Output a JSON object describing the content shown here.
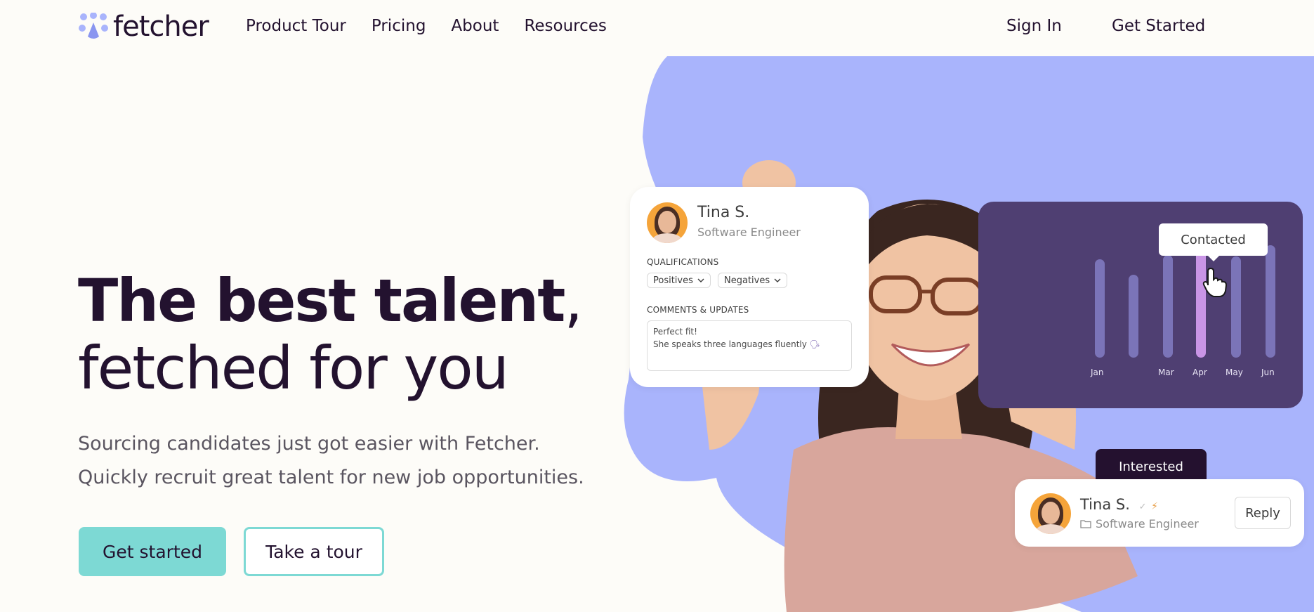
{
  "nav": {
    "logo_text": "fetcher",
    "links": [
      "Product Tour",
      "Pricing",
      "About",
      "Resources"
    ],
    "sign_in": "Sign In",
    "get_started": "Get Started"
  },
  "hero": {
    "title_bold": "The best talent",
    "title_comma": ",",
    "title_light": "fetched for you",
    "subtitle_lines": [
      "Sourcing candidates just got easier with Fetcher.",
      "Quickly recruit great talent for new job opportunities."
    ],
    "primary_cta": "Get started",
    "secondary_cta": "Take a tour"
  },
  "profile_card": {
    "name": "Tina S.",
    "role": "Software Engineer",
    "qualifications_label": "QUALIFICATIONS",
    "pills": [
      "Positives",
      "Negatives"
    ],
    "comments_label": "COMMENTS & UPDATES",
    "comment_line1": "Perfect fit!",
    "comment_line2": "She speaks three languages fluently"
  },
  "chart_card": {
    "tooltip": "Contacted",
    "months": [
      "Jan",
      "Mar",
      "Apr",
      "May",
      "Jun"
    ],
    "highlight_month": "Apr"
  },
  "reply_card": {
    "badge": "Interested",
    "name": "Tina S.",
    "role": "Software Engineer",
    "reply_label": "Reply"
  },
  "colors": {
    "brand_dark": "#23122f",
    "accent_teal": "#7dd9d4",
    "blob_blue": "#a9b4fc",
    "chart_purple": "#4f3f72"
  }
}
